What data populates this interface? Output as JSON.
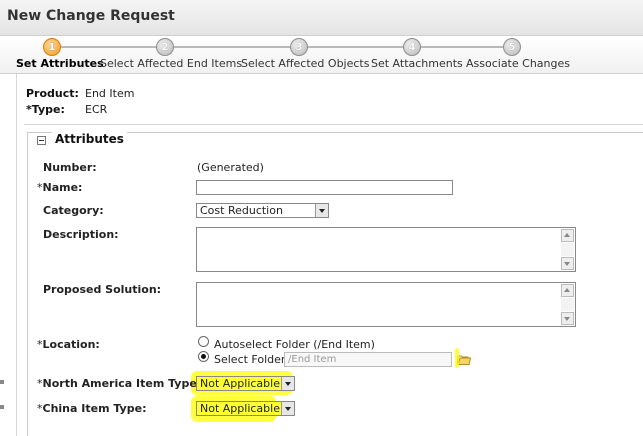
{
  "window": {
    "title": "New Change Request"
  },
  "wizard": {
    "steps": [
      {
        "number": "1",
        "label": "Set Attributes",
        "active": true
      },
      {
        "number": "2",
        "label": "Select Affected End Items",
        "active": false
      },
      {
        "number": "3",
        "label": "Select Affected Objects",
        "active": false
      },
      {
        "number": "4",
        "label": "Set Attachments",
        "active": false
      },
      {
        "number": "5",
        "label": "Associate Changes",
        "active": false
      }
    ]
  },
  "header_info": {
    "product_label": "Product:",
    "product_value": "End Item",
    "type_label": "*Type:",
    "type_value": "ECR"
  },
  "attributes": {
    "section_title": "Attributes",
    "number": {
      "label": "Number:",
      "value": "(Generated)"
    },
    "name": {
      "label": "Name:",
      "required": "*",
      "value": ""
    },
    "category": {
      "label": "Category:",
      "value": "Cost Reduction"
    },
    "description": {
      "label": "Description:",
      "value": ""
    },
    "proposed_solution": {
      "label": "Proposed Solution:",
      "value": ""
    },
    "location": {
      "label": "Location:",
      "required": "*",
      "option_autoselect": "Autoselect Folder (/End Item)",
      "option_select": "Select Folder",
      "selected": "select",
      "folder_placeholder": "/End Item"
    },
    "north_america_item_type": {
      "label": "North America Item Type:",
      "required": "*",
      "value": "Not Applicable"
    },
    "china_item_type": {
      "label": "China Item Type:",
      "required": "*",
      "value": "Not Applicable"
    }
  },
  "colors": {
    "highlight": "#ffff00",
    "active_step": "#f39a1e"
  }
}
